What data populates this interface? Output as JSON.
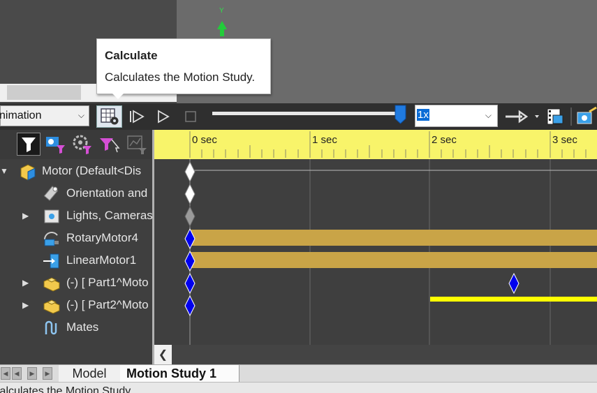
{
  "viewport": {
    "axis_label": "Y"
  },
  "tooltip": {
    "title": "Calculate",
    "description": "Calculates the Motion Study."
  },
  "toolbar": {
    "study_type": "nimation",
    "playback_speed": "1x",
    "icons": [
      "calculate-icon",
      "play-from-start-icon",
      "play-icon",
      "stop-icon",
      "playback-slider",
      "speed-select",
      "playback-mode-icon",
      "save-animation-icon",
      "animation-wizard-icon"
    ]
  },
  "tree": {
    "items": [
      {
        "label": "Motor  (Default<Dis",
        "icon": "assembly-icon",
        "expander": "collapse"
      },
      {
        "label": "Orientation and",
        "icon": "camera-view-icon",
        "expander": ""
      },
      {
        "label": "Lights, Cameras",
        "icon": "lights-icon",
        "expander": "expand"
      },
      {
        "label": "RotaryMotor4",
        "icon": "rotary-motor-icon",
        "expander": ""
      },
      {
        "label": "LinearMotor1",
        "icon": "linear-motor-icon",
        "expander": ""
      },
      {
        "label": "(-) [ Part1^Moto",
        "icon": "part-icon",
        "expander": "expand"
      },
      {
        "label": "(-) [ Part2^Moto",
        "icon": "part-icon",
        "expander": "expand"
      },
      {
        "label": "Mates",
        "icon": "mates-icon",
        "expander": ""
      }
    ]
  },
  "timeline": {
    "time_labels": [
      "0 sec",
      "1 sec",
      "2 sec",
      "3 sec"
    ],
    "colors": {
      "ruler": "#f8f46a",
      "motor_bar": "#c9a447",
      "part_bar": "#ffff00",
      "key_blue": "#0000ee"
    }
  },
  "tabs": {
    "model": "Model",
    "motion_study": "Motion Study 1"
  },
  "status_bar": {
    "text": "Calculates the Motion Study."
  }
}
